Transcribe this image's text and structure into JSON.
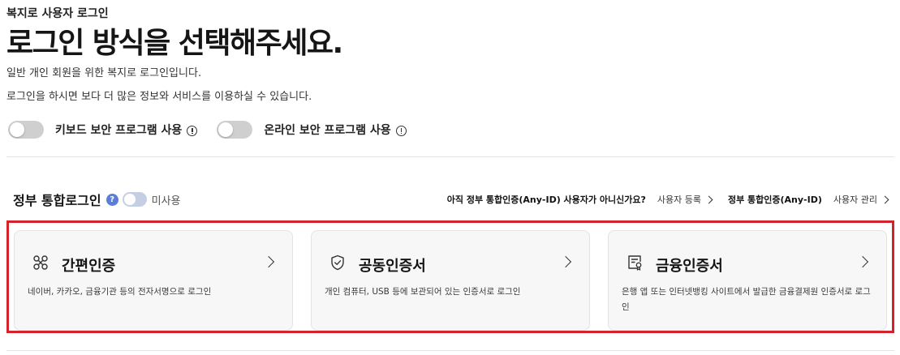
{
  "header": {
    "eyebrow": "복지로 사용자 로그인",
    "title": "로그인 방식을 선택해주세요.",
    "desc1": "일반 개인 회원을 위한 복지로 로그인입니다.",
    "desc2": "로그인을 하시면 보다 더 많은 정보와 서비스를 이용하실 수 있습니다."
  },
  "toggles": [
    {
      "label": "키보드 보안 프로그램 사용",
      "state": "off"
    },
    {
      "label": "온라인 보안 프로그램 사용",
      "state": "off"
    }
  ],
  "gov": {
    "label": "정부 통합로그인",
    "help": "?",
    "status": "미사용",
    "question": "아직 정부 통합인증(Any-ID) 사용자가 아니신가요?",
    "register": "사용자 등록",
    "anyid": "정부 통합인증(Any-ID)",
    "manage": "사용자 관리"
  },
  "cards": [
    {
      "title": "간편인증",
      "desc": "네이버, 카카오, 금융기관 등의 전자서명으로 로그인",
      "icon": "link-icon"
    },
    {
      "title": "공동인증서",
      "desc": "개인 컴퓨터, USB 등에 보관되어 있는 인증서로 로그인",
      "icon": "shield-check-icon"
    },
    {
      "title": "금융인증서",
      "desc": "은행 앱 또는 인터넷뱅킹 사이트에서 발급한 금융결제원 인증서로 로그인",
      "icon": "certificate-icon"
    }
  ],
  "colors": {
    "highlight_border": "#d3222a",
    "help_badge": "#5b7fd6"
  }
}
